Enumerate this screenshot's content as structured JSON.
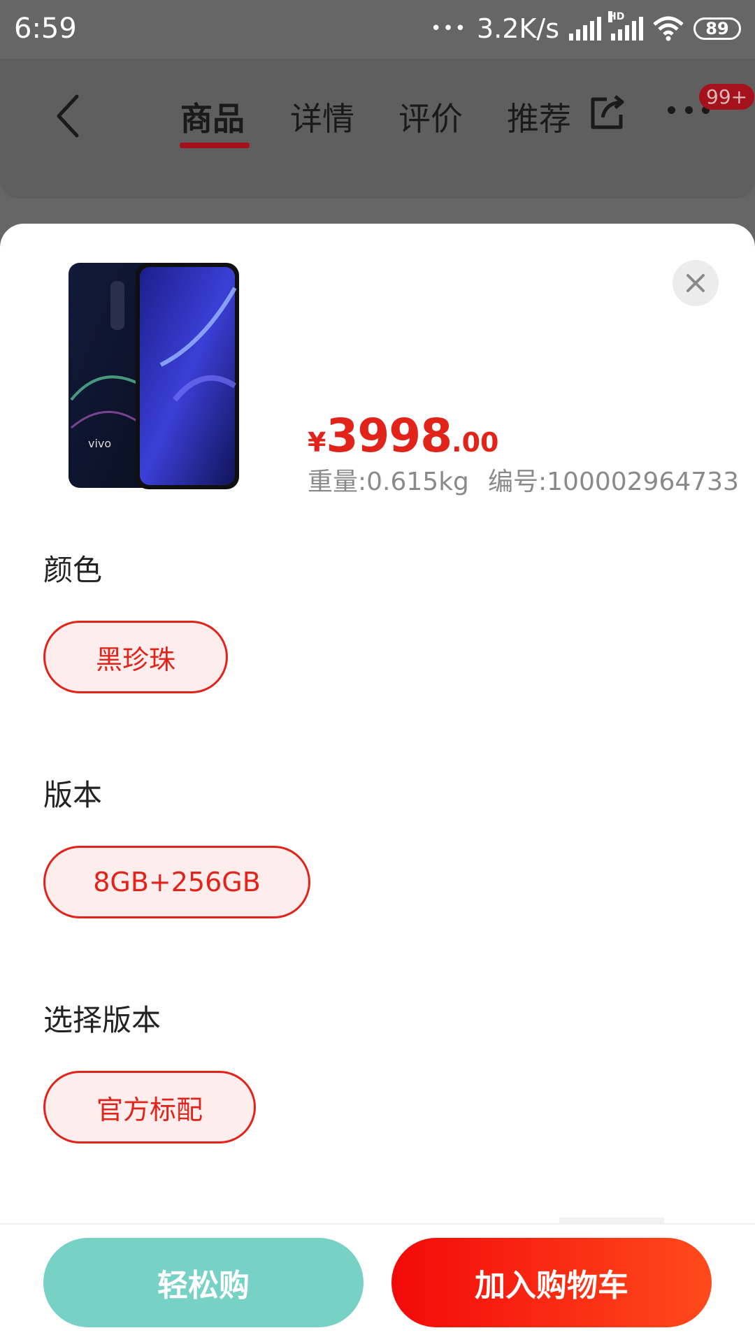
{
  "status_bar": {
    "time": "6:59",
    "dots": "•••",
    "speed": "3.2K/s",
    "hd_label": "HD",
    "battery": "89"
  },
  "header": {
    "tabs": [
      {
        "label": "商品",
        "active": true
      },
      {
        "label": "详情",
        "active": false
      },
      {
        "label": "评价",
        "active": false
      },
      {
        "label": "推荐",
        "active": false
      }
    ],
    "badge": "99+",
    "icons": [
      "back-icon",
      "share-icon",
      "more-icon"
    ]
  },
  "product": {
    "brand_on_image": "vivo",
    "price_symbol": "¥",
    "price_integer": "3998",
    "price_decimal": ".00",
    "weight": "重量:0.615kg",
    "sku": "编号:100002964733"
  },
  "options": [
    {
      "title": "颜色",
      "selected": "黑珍珠"
    },
    {
      "title": "版本",
      "selected": "8GB+256GB"
    },
    {
      "title": "选择版本",
      "selected": "官方标配"
    }
  ],
  "actions": {
    "easy_buy": "轻松购",
    "add_to_cart": "加入购物车"
  },
  "colors": {
    "accent_red": "#e2231a",
    "chip_bg": "#fdeeed",
    "easy_buy_bg": "#77d1c4",
    "overlay_dim": "#666666"
  }
}
